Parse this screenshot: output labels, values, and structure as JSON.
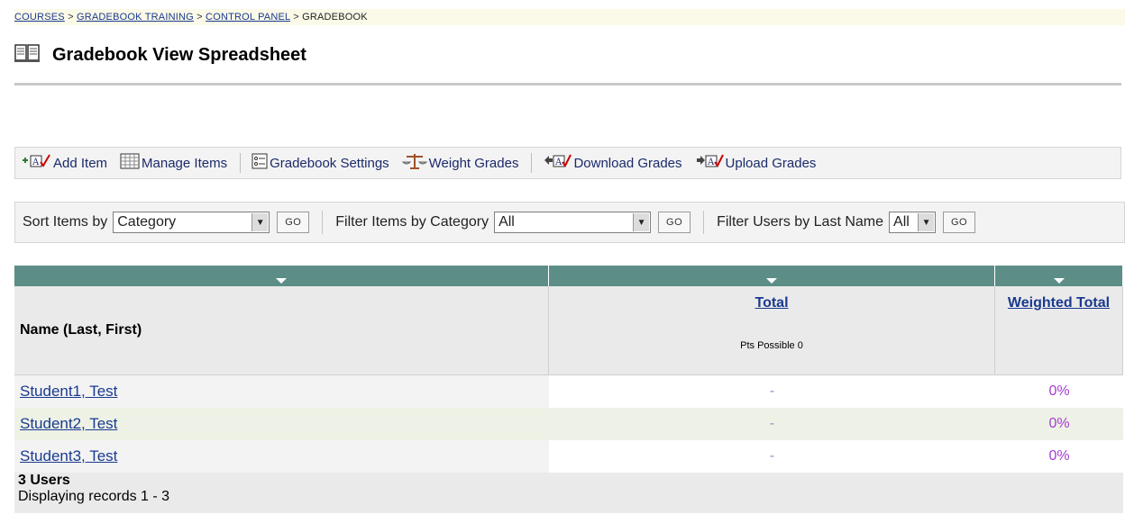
{
  "breadcrumb": {
    "items": [
      "COURSES",
      "GRADEBOOK TRAINING",
      "CONTROL PANEL"
    ],
    "current": "GRADEBOOK",
    "separator": ">"
  },
  "page": {
    "title": "Gradebook View Spreadsheet",
    "icon": "book-icon"
  },
  "actions": {
    "add_item": "Add Item",
    "manage_items": "Manage Items",
    "gradebook_settings": "Gradebook Settings",
    "weight_grades": "Weight Grades",
    "download_grades": "Download Grades",
    "upload_grades": "Upload Grades"
  },
  "filters": {
    "sort_label": "Sort Items by",
    "sort_value": "Category",
    "category_label": "Filter Items by Category",
    "category_value": "All",
    "users_label": "Filter Users by Last Name",
    "users_value": "All",
    "go_label": "GO"
  },
  "table": {
    "col_name": "Name (Last, First)",
    "col_total": "Total",
    "pts_possible": "Pts Possible 0",
    "col_weighted": "Weighted Total",
    "rows": [
      {
        "name": "Student1, Test",
        "total": "-",
        "weighted": "0%"
      },
      {
        "name": "Student2, Test",
        "total": "-",
        "weighted": "0%"
      },
      {
        "name": "Student3, Test",
        "total": "-",
        "weighted": "0%"
      }
    ]
  },
  "footer": {
    "users_count": "3 Users",
    "displaying": "Displaying records 1 - 3"
  },
  "colors": {
    "header_teal": "#5c8e87",
    "link": "#1a3a8f",
    "weighted_purple": "#a53cd0",
    "alt_row": "#eef2e6"
  }
}
